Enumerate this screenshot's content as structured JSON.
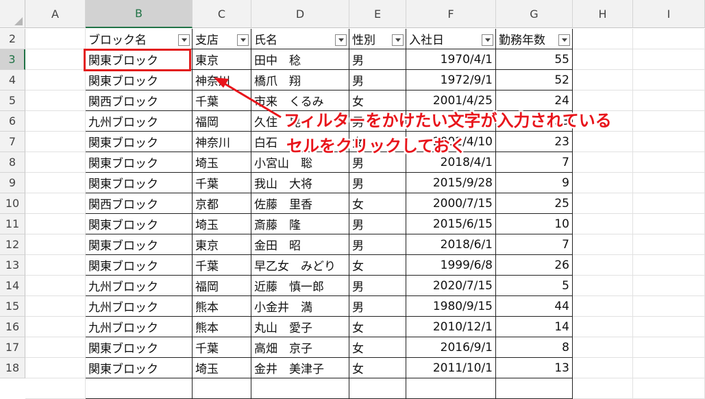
{
  "columns": [
    "A",
    "B",
    "C",
    "D",
    "E",
    "F",
    "G",
    "H",
    "I"
  ],
  "selected_column": "B",
  "row_numbers": [
    "2",
    "3",
    "4",
    "5",
    "6",
    "7",
    "8",
    "9",
    "10",
    "11",
    "12",
    "13",
    "14",
    "15",
    "16",
    "17",
    "18"
  ],
  "selected_row": "3",
  "table_headers": [
    "ブロック名",
    "支店",
    "氏名",
    "性別",
    "入社日",
    "勤務年数"
  ],
  "rows": [
    [
      "関東ブロック",
      "東京",
      "田中　稔",
      "男",
      "1970/4/1",
      "55"
    ],
    [
      "関東ブロック",
      "神奈川",
      "橋爪　翔",
      "男",
      "1972/9/1",
      "52"
    ],
    [
      "関西ブロック",
      "千葉",
      "市来　くるみ",
      "女",
      "2001/4/25",
      "24"
    ],
    [
      "九州ブロック",
      "福岡",
      "久住　晃",
      "男",
      "",
      "33"
    ],
    [
      "関東ブロック",
      "神奈川",
      "白石",
      "女",
      "2002/4/10",
      "23"
    ],
    [
      "関東ブロック",
      "埼玉",
      "小宮山　聡",
      "男",
      "2018/4/1",
      "7"
    ],
    [
      "関東ブロック",
      "千葉",
      "我山　大将",
      "男",
      "2015/9/28",
      "9"
    ],
    [
      "関西ブロック",
      "京都",
      "佐藤　里香",
      "女",
      "2000/7/15",
      "25"
    ],
    [
      "関東ブロック",
      "埼玉",
      "斎藤　隆",
      "男",
      "2015/6/15",
      "10"
    ],
    [
      "関東ブロック",
      "東京",
      "金田　昭",
      "男",
      "2018/6/1",
      "7"
    ],
    [
      "関東ブロック",
      "千葉",
      "早乙女　みどり",
      "女",
      "1999/6/8",
      "26"
    ],
    [
      "九州ブロック",
      "福岡",
      "近藤　慎一郎",
      "男",
      "2020/7/15",
      "5"
    ],
    [
      "九州ブロック",
      "熊本",
      "小金井　満",
      "男",
      "1980/9/15",
      "44"
    ],
    [
      "九州ブロック",
      "熊本",
      "丸山　愛子",
      "女",
      "2010/12/1",
      "14"
    ],
    [
      "関東ブロック",
      "千葉",
      "高畑　京子",
      "女",
      "2016/9/1",
      "8"
    ],
    [
      "関東ブロック",
      "埼玉",
      "金井　美津子",
      "女",
      "2011/10/1",
      "13"
    ]
  ],
  "annotation": {
    "line1": "フィルターをかけたい文字が入力されている",
    "line2": "セルをクリックしておく",
    "color": "#e8141b"
  }
}
